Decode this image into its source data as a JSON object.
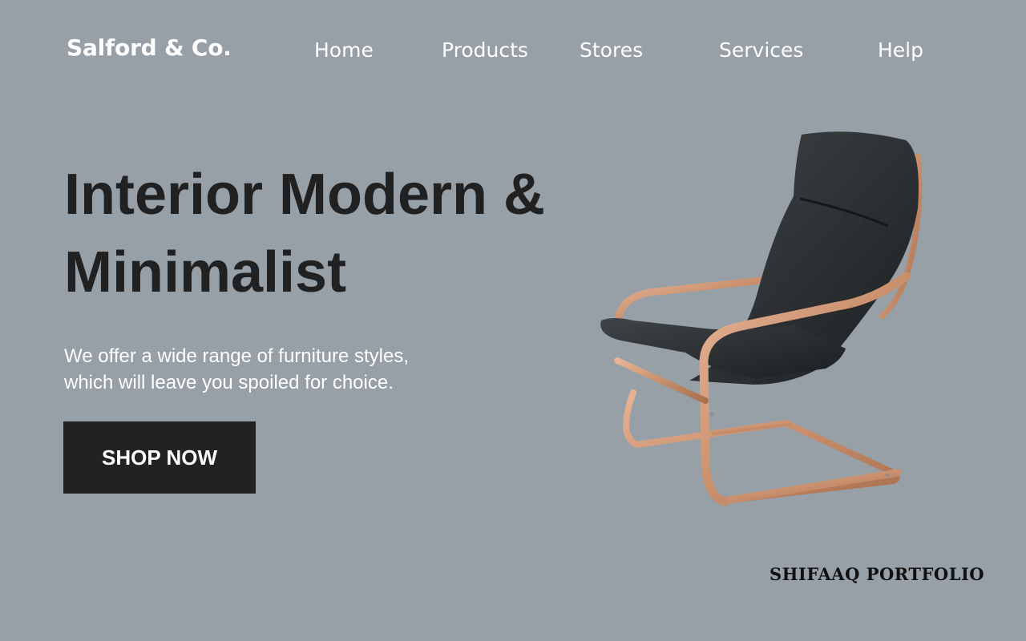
{
  "header": {
    "brand": "Salford & Co.",
    "nav": {
      "home": "Home",
      "products": "Products",
      "stores": "Stores",
      "services": "Services",
      "help": "Help"
    }
  },
  "hero": {
    "title": "Interior Modern & Minimalist",
    "description": "We offer a wide range of furniture styles, which will leave you spoiled for choice.",
    "cta_label": "SHOP NOW",
    "image": "armchair-photo"
  },
  "footer": {
    "watermark": "SHIFAAQ PORTFOLIO"
  },
  "colors": {
    "background": "#979fa7",
    "headline": "#212121",
    "button_bg": "#222222",
    "text_light": "#ffffff"
  }
}
